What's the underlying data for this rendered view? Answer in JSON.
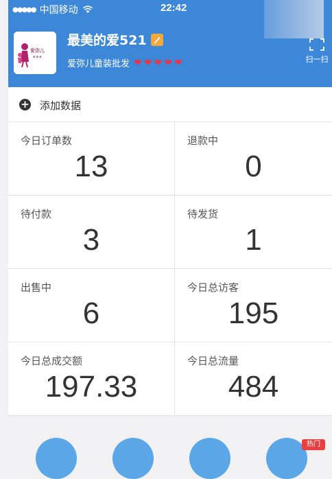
{
  "status_bar": {
    "carrier": "中国移动",
    "time": "22:42"
  },
  "store": {
    "name": "最美的爱521",
    "subtitle": "爱弥儿童装批发",
    "logo_text": "爱弥儿",
    "scan_label": "扫一扫",
    "heart_count": 5
  },
  "add_data": {
    "label": "添加数据"
  },
  "stats": [
    {
      "label": "今日订单数",
      "value": "13"
    },
    {
      "label": "退款中",
      "value": "0"
    },
    {
      "label": "待付款",
      "value": "3"
    },
    {
      "label": "待发货",
      "value": "1"
    },
    {
      "label": "出售中",
      "value": "6"
    },
    {
      "label": "今日总访客",
      "value": "195"
    },
    {
      "label": "今日总成交额",
      "value": "197.33"
    },
    {
      "label": "今日总流量",
      "value": "484"
    }
  ],
  "colors": {
    "header_blue": "#3d87d8",
    "heart_red": "#e8334a"
  },
  "badges": {
    "hot": "热门"
  }
}
